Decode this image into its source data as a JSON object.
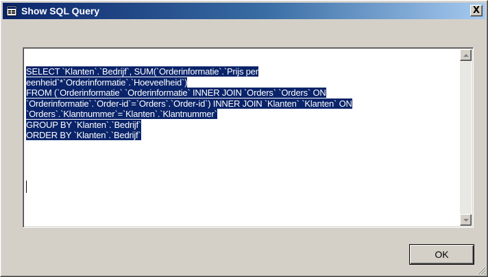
{
  "window": {
    "title": "Show SQL Query",
    "icon": "app-window-icon",
    "close_glyph": "X"
  },
  "query": {
    "lines": [
      " SELECT `Klanten`.`Bedrijf`,  SUM(`Orderinformatie`.`Prijs per",
      "eenheid`*`Orderinformatie`.`Hoeveelheid`)",
      " FROM   (`Orderinformatie` `Orderinformatie` INNER JOIN `Orders` `Orders` ON",
      "`Orderinformatie`.`Order-id`=`Orders`.`Order-id`) INNER JOIN `Klanten` `Klanten` ON",
      "`Orders`.`Klantnummer`=`Klanten`.`Klantnummer`",
      " GROUP BY `Klanten`.`Bedrijf`",
      " ORDER BY `Klanten`.`Bedrijf`"
    ],
    "selection_color": "#0a246a"
  },
  "buttons": {
    "ok_label": "OK"
  },
  "colors": {
    "titlebar_start": "#0a246a",
    "titlebar_end": "#a6caf0",
    "face": "#d4d0c8"
  }
}
